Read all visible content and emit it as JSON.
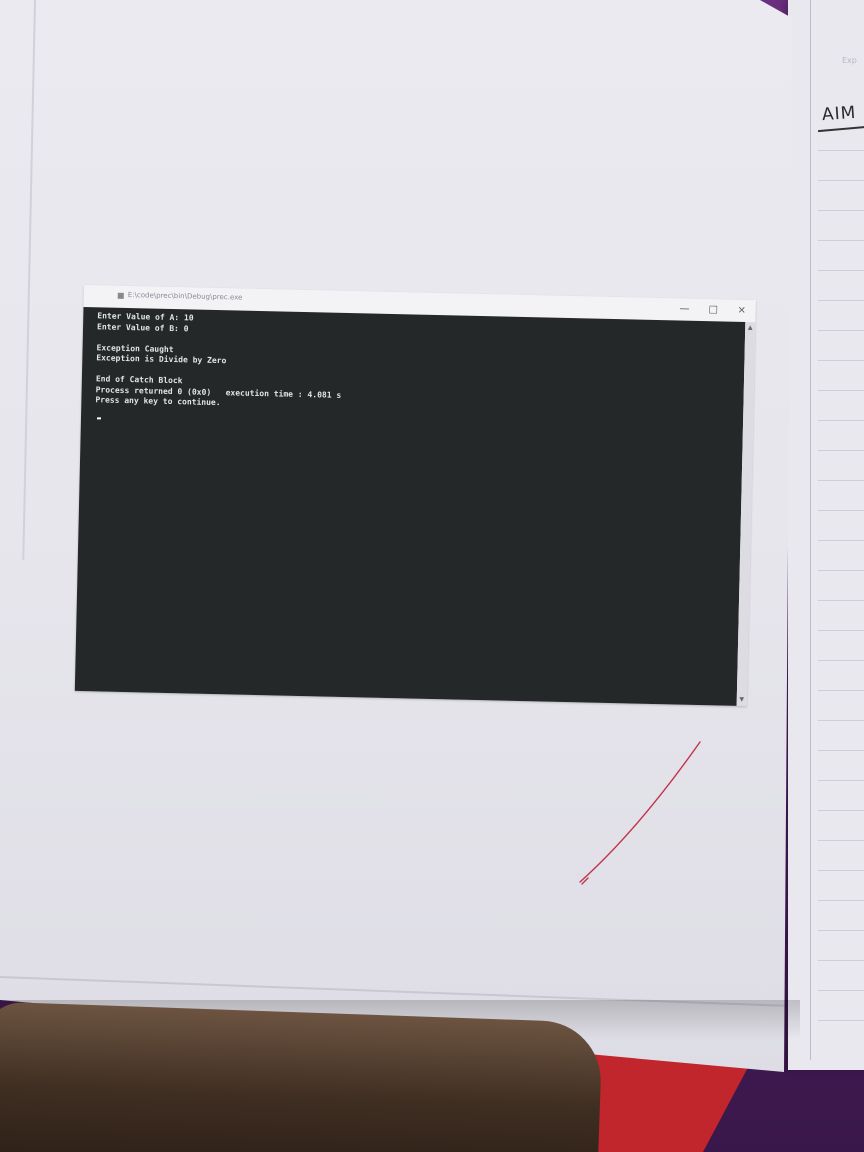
{
  "window": {
    "title": "E:\\code\\prec\\bin\\Debug\\prec.exe",
    "minimize": "—",
    "maximize": "□",
    "close": "×"
  },
  "console": {
    "lines": [
      "Enter Value of A: 10",
      "Enter Value of B: 0",
      "",
      "Exception Caught",
      "Exception is Divide by Zero",
      "",
      "End of Catch Block",
      "Process returned 0 (0x0)   execution time : 4.081 s",
      "Press any key to continue."
    ]
  },
  "notebook": {
    "right_page_heading": "AIM",
    "right_page_corner": "Exp"
  },
  "colors": {
    "console_bg": "#252829",
    "console_text": "#e2e4e6",
    "tick": "#c2334a"
  },
  "icons": {
    "title_icon": "console-app-icon",
    "tick": "check-mark"
  }
}
